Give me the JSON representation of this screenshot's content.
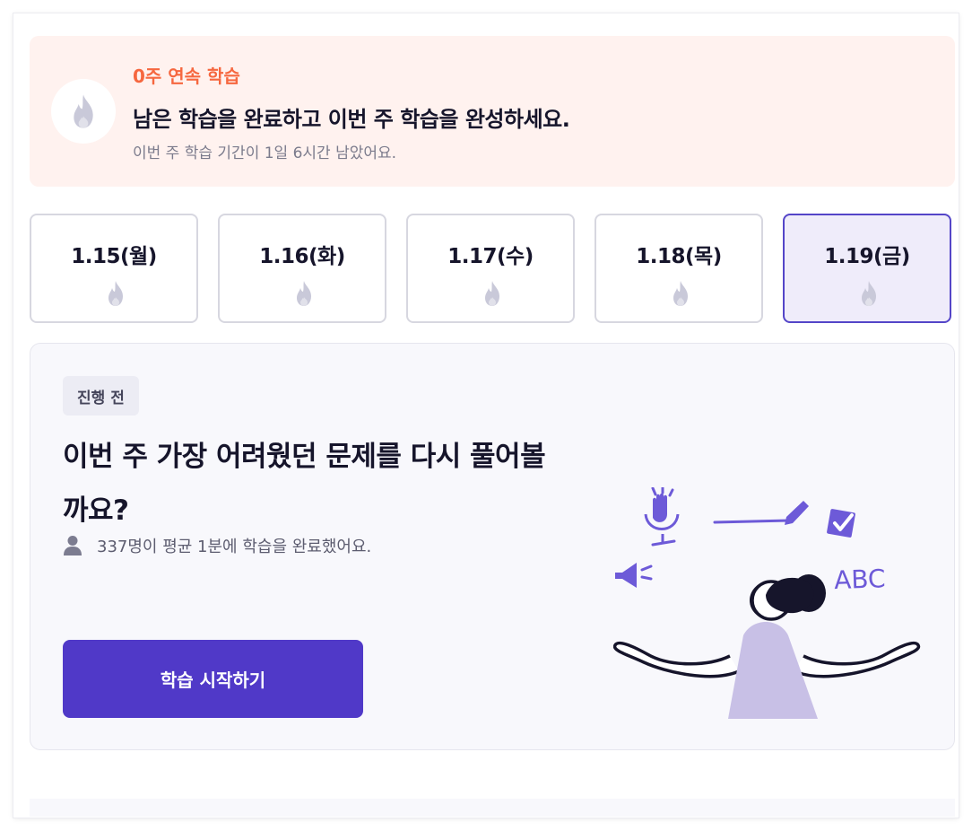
{
  "banner": {
    "streak": "0주 연속 학습",
    "title": "남은 학습을 완료하고 이번 주 학습을 완성하세요.",
    "subtitle": "이번 주 학습 기간이 1일 6시간 남았어요.",
    "icon": "flame-icon"
  },
  "days": [
    {
      "label": "1.15(월)",
      "active": false
    },
    {
      "label": "1.16(화)",
      "active": false
    },
    {
      "label": "1.17(수)",
      "active": false
    },
    {
      "label": "1.18(목)",
      "active": false
    },
    {
      "label": "1.19(금)",
      "active": true
    }
  ],
  "card": {
    "status": "진행 전",
    "title": "이번 주 가장 어려웠던 문제를 다시 풀어볼까요?",
    "participants": "337명이 평균 1분에 학습을 완료했어요.",
    "start_label": "학습 시작하기",
    "illustration_text": "ABC"
  },
  "colors": {
    "accent": "#5039c8",
    "streak": "#f6673f",
    "banner_bg": "#fff2ef",
    "active_day_bg": "#efecfa",
    "flame": "#c9c9d9"
  }
}
